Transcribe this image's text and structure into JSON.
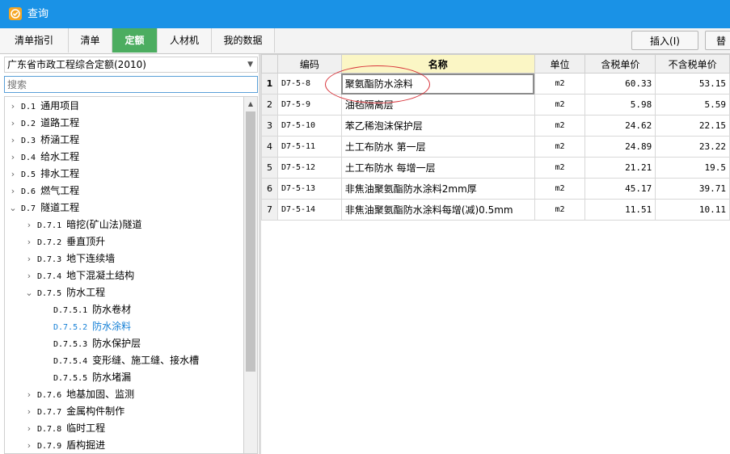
{
  "window": {
    "title": "查询",
    "icon": "app-logo-icon",
    "accent": "#1a92e6"
  },
  "tabs": [
    {
      "label": "清单指引",
      "active": false
    },
    {
      "label": "清单",
      "active": false
    },
    {
      "label": "定额",
      "active": true
    },
    {
      "label": "人材机",
      "active": false
    },
    {
      "label": "我的数据",
      "active": false
    }
  ],
  "toolbar": {
    "insert_label": "插入(I)",
    "replace_label": "替"
  },
  "left": {
    "quota_library": "广东省市政工程综合定额(2010)",
    "search_placeholder": "搜索",
    "tree": [
      {
        "code": "D.1",
        "label": "通用项目",
        "level": 0,
        "expanded": false
      },
      {
        "code": "D.2",
        "label": "道路工程",
        "level": 0,
        "expanded": false
      },
      {
        "code": "D.3",
        "label": "桥涵工程",
        "level": 0,
        "expanded": false
      },
      {
        "code": "D.4",
        "label": "给水工程",
        "level": 0,
        "expanded": false
      },
      {
        "code": "D.5",
        "label": "排水工程",
        "level": 0,
        "expanded": false
      },
      {
        "code": "D.6",
        "label": "燃气工程",
        "level": 0,
        "expanded": false
      },
      {
        "code": "D.7",
        "label": "隧道工程",
        "level": 0,
        "expanded": true
      },
      {
        "code": "D.7.1",
        "label": "暗挖(矿山法)隧道",
        "level": 1,
        "expanded": false
      },
      {
        "code": "D.7.2",
        "label": "垂直顶升",
        "level": 1,
        "expanded": false
      },
      {
        "code": "D.7.3",
        "label": "地下连续墙",
        "level": 1,
        "expanded": false
      },
      {
        "code": "D.7.4",
        "label": "地下混凝土结构",
        "level": 1,
        "expanded": false
      },
      {
        "code": "D.7.5",
        "label": "防水工程",
        "level": 1,
        "expanded": true
      },
      {
        "code": "D.7.5.1",
        "label": "防水卷材",
        "level": 2,
        "leaf": true
      },
      {
        "code": "D.7.5.2",
        "label": "防水涂料",
        "level": 2,
        "leaf": true,
        "selected": true
      },
      {
        "code": "D.7.5.3",
        "label": "防水保护层",
        "level": 2,
        "leaf": true
      },
      {
        "code": "D.7.5.4",
        "label": "变形缝、施工缝、接水槽",
        "level": 2,
        "leaf": true
      },
      {
        "code": "D.7.5.5",
        "label": "防水堵漏",
        "level": 2,
        "leaf": true
      },
      {
        "code": "D.7.6",
        "label": "地基加固、监测",
        "level": 1,
        "expanded": false
      },
      {
        "code": "D.7.7",
        "label": "金属构件制作",
        "level": 1,
        "expanded": false
      },
      {
        "code": "D.7.8",
        "label": "临时工程",
        "level": 1,
        "expanded": false
      },
      {
        "code": "D.7.9",
        "label": "盾构掘进",
        "level": 1,
        "expanded": false
      }
    ]
  },
  "grid": {
    "headers": [
      "",
      "编码",
      "名称",
      "单位",
      "含税单价",
      "不含税单价"
    ],
    "rows": [
      {
        "num": "1",
        "code": "D7-5-8",
        "name": "聚氨酯防水涂料",
        "unit": "m2",
        "price_tax": "60.33",
        "price_notax": "53.15"
      },
      {
        "num": "2",
        "code": "D7-5-9",
        "name": "油毡隔离层",
        "unit": "m2",
        "price_tax": "5.98",
        "price_notax": "5.59"
      },
      {
        "num": "3",
        "code": "D7-5-10",
        "name": "苯乙稀泡沫保护层",
        "unit": "m2",
        "price_tax": "24.62",
        "price_notax": "22.15"
      },
      {
        "num": "4",
        "code": "D7-5-11",
        "name": "土工布防水 第一层",
        "unit": "m2",
        "price_tax": "24.89",
        "price_notax": "23.22"
      },
      {
        "num": "5",
        "code": "D7-5-12",
        "name": "土工布防水 每增一层",
        "unit": "m2",
        "price_tax": "21.21",
        "price_notax": "19.5"
      },
      {
        "num": "6",
        "code": "D7-5-13",
        "name": "非焦油聚氨酯防水涂料2mm厚",
        "unit": "m2",
        "price_tax": "45.17",
        "price_notax": "39.71"
      },
      {
        "num": "7",
        "code": "D7-5-14",
        "name": "非焦油聚氨酯防水涂料每增(减)0.5mm",
        "unit": "m2",
        "price_tax": "11.51",
        "price_notax": "10.11"
      }
    ]
  },
  "colors": {
    "active_tab": "#4cad60",
    "selected_node": "#1680d6",
    "name_header": "#fbf6c5",
    "annotation": "#d8343b"
  }
}
